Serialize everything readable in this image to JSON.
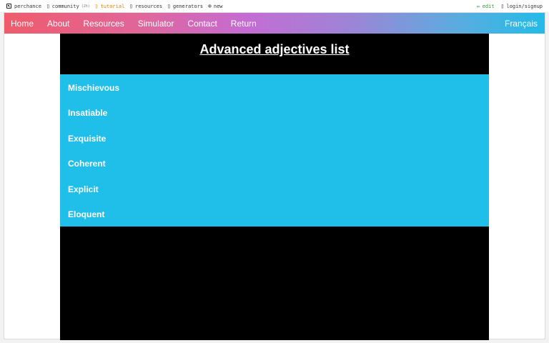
{
  "toolbar": {
    "site": "perchance",
    "community": "community",
    "community_badge": "(2h)",
    "tutorial": "tutorial",
    "resources": "resources",
    "generators": "generators",
    "new": "new",
    "edit": "edit",
    "login": "login/signup"
  },
  "nav": {
    "items": [
      "Home",
      "About",
      "Resources",
      "Simulator",
      "Contact",
      "Return"
    ],
    "language": "Français"
  },
  "page": {
    "title": "Advanced adjectives list",
    "adjectives": [
      "Mischievous",
      "Insatiable",
      "Exquisite",
      "Coherent",
      "Explicit",
      "Eloquent"
    ]
  },
  "colors": {
    "list_background": "#1fbfea",
    "content_background": "#000000",
    "nav_gradient_start": "#ef5b6c",
    "nav_gradient_end": "#22bbe8"
  }
}
